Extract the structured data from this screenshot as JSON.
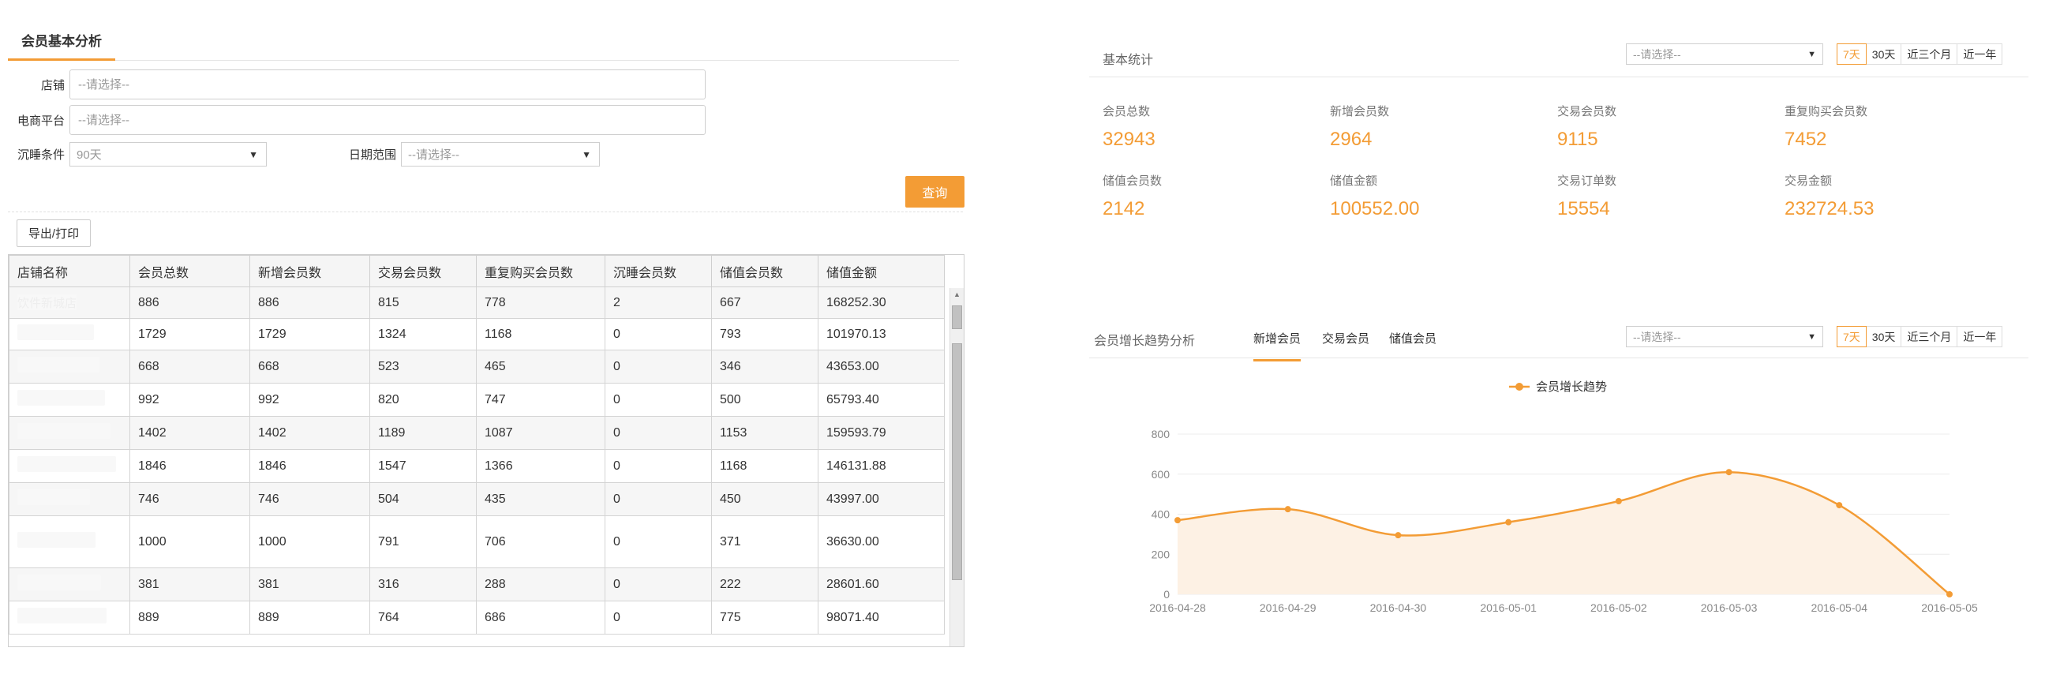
{
  "left": {
    "tab_title": "会员基本分析",
    "form": {
      "store_label": "店铺",
      "store_placeholder": "--请选择--",
      "platform_label": "电商平台",
      "platform_placeholder": "--请选择--",
      "dormant_label": "沉睡条件",
      "dormant_value": "90天",
      "date_label": "日期范围",
      "date_value": "--请选择--",
      "query_label": "查询"
    },
    "export_label": "导出/打印",
    "table": {
      "columns": [
        "店铺名称",
        "会员总数",
        "新增会员数",
        "交易会员数",
        "重复购买会员数",
        "沉睡会员数",
        "储值会员数",
        "储值金额"
      ],
      "rows": [
        [
          "饮件新城店",
          "886",
          "886",
          "815",
          "778",
          "2",
          "667",
          "168252.30"
        ],
        [
          "",
          "1729",
          "1729",
          "1324",
          "1168",
          "0",
          "793",
          "101970.13"
        ],
        [
          "",
          "668",
          "668",
          "523",
          "465",
          "0",
          "346",
          "43653.00"
        ],
        [
          "",
          "992",
          "992",
          "820",
          "747",
          "0",
          "500",
          "65793.40"
        ],
        [
          "",
          "1402",
          "1402",
          "1189",
          "1087",
          "0",
          "1153",
          "159593.79"
        ],
        [
          "",
          "1846",
          "1846",
          "1547",
          "1366",
          "0",
          "1168",
          "146131.88"
        ],
        [
          "",
          "746",
          "746",
          "504",
          "435",
          "0",
          "450",
          "43997.00"
        ],
        [
          "",
          "1000",
          "1000",
          "791",
          "706",
          "0",
          "371",
          "36630.00"
        ],
        [
          "",
          "381",
          "381",
          "316",
          "288",
          "0",
          "222",
          "28601.60"
        ],
        [
          "",
          "889",
          "889",
          "764",
          "686",
          "0",
          "775",
          "98071.40"
        ]
      ]
    }
  },
  "basic": {
    "title": "基本统计",
    "select_value": "--请选择--",
    "ranges": [
      "7天",
      "30天",
      "近三个月",
      "近一年"
    ],
    "active_range": "7天",
    "stats": [
      {
        "label": "会员总数",
        "value": "32943"
      },
      {
        "label": "新增会员数",
        "value": "2964"
      },
      {
        "label": "交易会员数",
        "value": "9115"
      },
      {
        "label": "重复购买会员数",
        "value": "7452"
      },
      {
        "label": "储值会员数",
        "value": "2142"
      },
      {
        "label": "储值金额",
        "value": "100552.00"
      },
      {
        "label": "交易订单数",
        "value": "15554"
      },
      {
        "label": "交易金额",
        "value": "232724.53"
      }
    ]
  },
  "trend": {
    "title": "会员增长趋势分析",
    "tabs": [
      "新增会员",
      "交易会员",
      "储值会员"
    ],
    "active_tab": "新增会员",
    "select_value": "--请选择--",
    "ranges": [
      "7天",
      "30天",
      "近三个月",
      "近一年"
    ],
    "active_range": "7天"
  },
  "chart_data": {
    "type": "area",
    "title": "",
    "legend": "会员增长趋势",
    "legend_position": "top-center",
    "x": [
      "2016-04-28",
      "2016-04-29",
      "2016-04-30",
      "2016-05-01",
      "2016-05-02",
      "2016-05-03",
      "2016-05-04",
      "2016-05-05"
    ],
    "series": [
      {
        "name": "会员增长趋势",
        "values": [
          370,
          425,
          295,
          360,
          465,
          610,
          445,
          0
        ]
      }
    ],
    "y_ticks": [
      0,
      200,
      400,
      600,
      800
    ],
    "ylim": [
      0,
      800
    ],
    "grid": true,
    "smooth": true,
    "color": "#f39c35",
    "fill_color": "#fdf1e4"
  }
}
